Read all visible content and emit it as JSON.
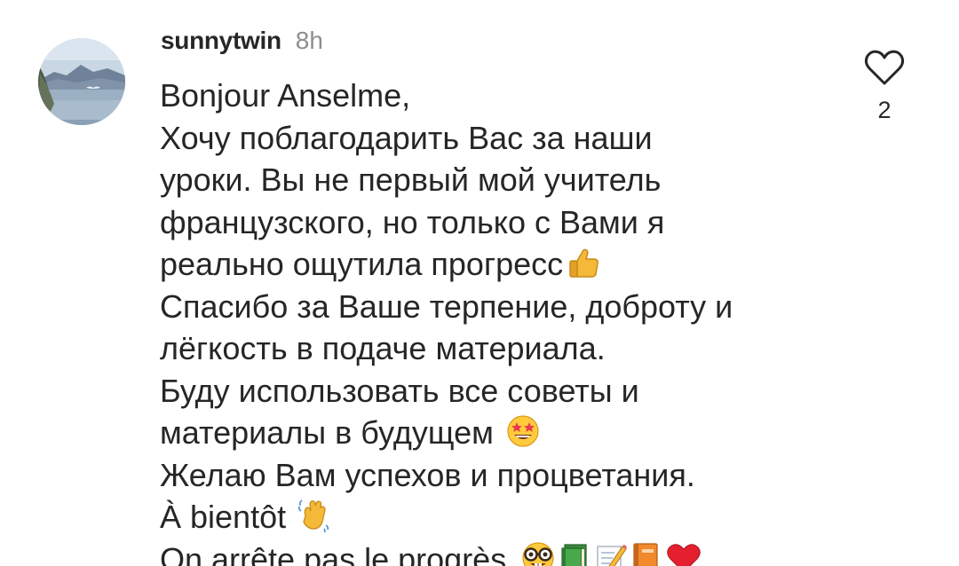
{
  "comment": {
    "username": "sunnytwin",
    "time": "8h",
    "lines": [
      "Bonjour Anselme,",
      "Хочу поблагодарить Вас за наши",
      "уроки. Вы не первый мой учитель",
      "французского, но только с Вами я",
      "реально ощутила прогресс",
      "Спасибо за Ваше терпение, доброту и",
      "лёгкость в подаче материала.",
      "Буду использовать все советы и",
      "материалы в будущем",
      "Желаю Вам успехов и процветания.",
      "À bientôt",
      "On arrête pas le progrès"
    ],
    "emoji": {
      "line5": "thumbs-up-icon",
      "line9": "star-struck-icon",
      "line11": "waving-hand-icon",
      "line12": [
        "nerd-face-icon",
        "green-book-icon",
        "memo-icon",
        "orange-book-icon",
        "red-heart-icon"
      ]
    },
    "likes": "2",
    "colors": {
      "text": "#262626",
      "muted": "#8e8e8e",
      "heart_outline": "#262626"
    }
  }
}
